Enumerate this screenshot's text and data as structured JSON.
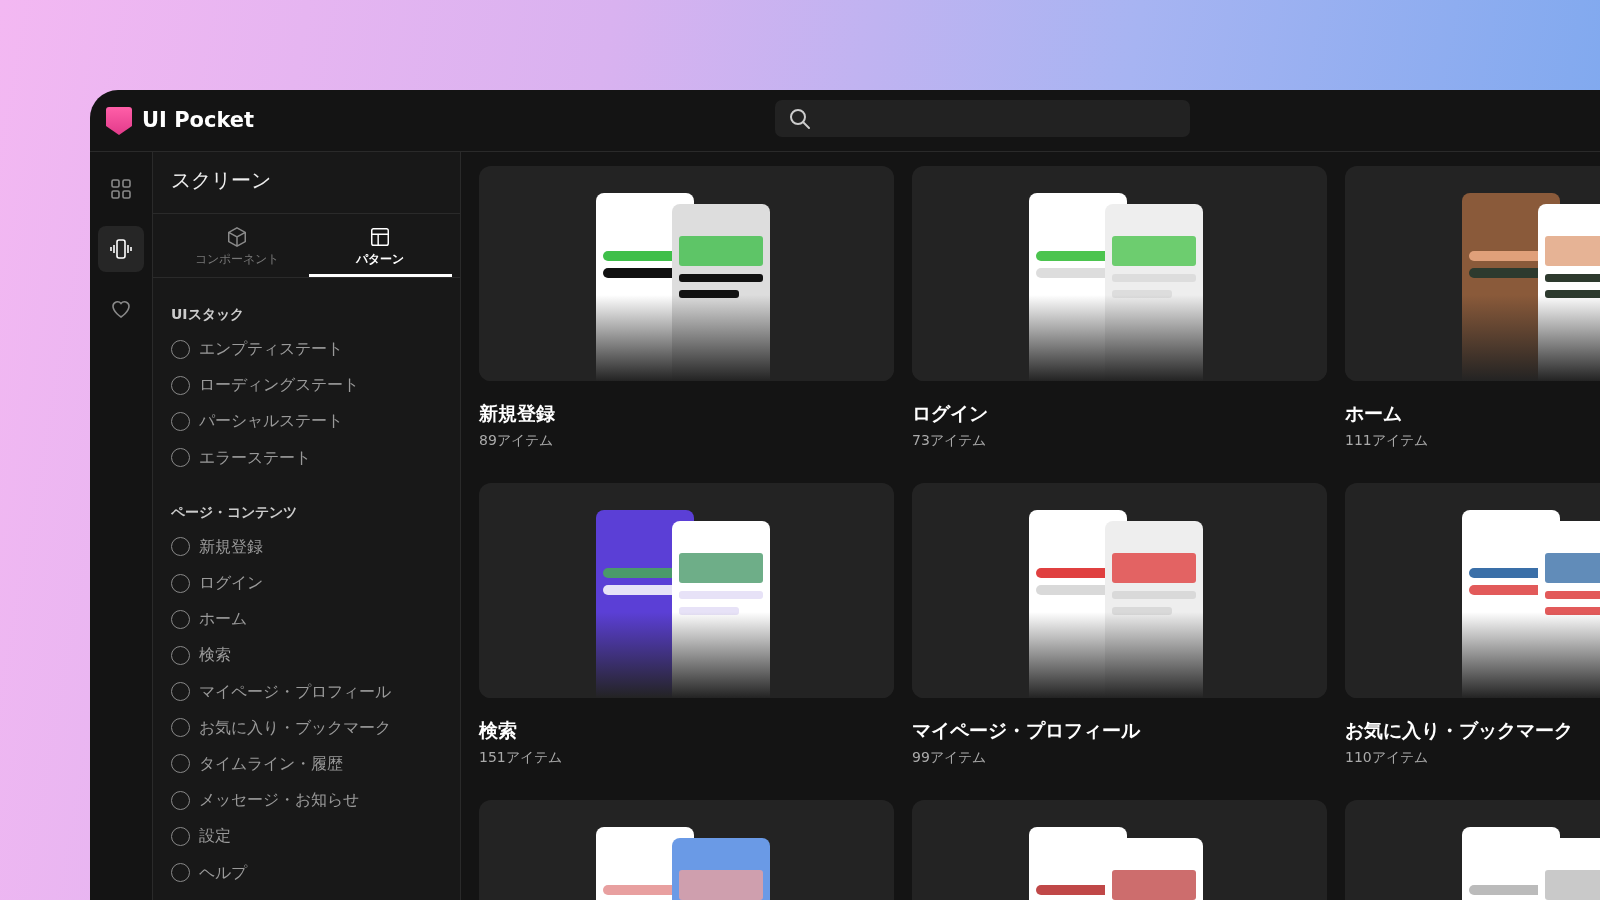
{
  "app": {
    "name": "UI Pocket"
  },
  "rail": [
    {
      "kind": "grid",
      "selected": false
    },
    {
      "kind": "phone",
      "selected": true
    },
    {
      "kind": "heart",
      "selected": false
    }
  ],
  "panel": {
    "title": "スクリーン",
    "tabs": [
      {
        "label": "コンポーネント",
        "kind": "cube",
        "selected": false
      },
      {
        "label": "パターン",
        "kind": "layout",
        "selected": true
      }
    ],
    "groups": [
      {
        "heading": "UIスタック",
        "items": [
          {
            "label": "エンプティステート",
            "checked": false
          },
          {
            "label": "ローディングステート",
            "checked": false
          },
          {
            "label": "パーシャルステート",
            "checked": false
          },
          {
            "label": "エラーステート",
            "checked": false
          }
        ]
      },
      {
        "heading": "ページ・コンテンツ",
        "items": [
          {
            "label": "新規登録",
            "checked": false
          },
          {
            "label": "ログイン",
            "checked": false
          },
          {
            "label": "ホーム",
            "checked": false
          },
          {
            "label": "検索",
            "checked": false
          },
          {
            "label": "マイページ・プロフィール",
            "checked": false
          },
          {
            "label": "お気に入り・ブックマーク",
            "checked": false
          },
          {
            "label": "タイムライン・履歴",
            "checked": false
          },
          {
            "label": "メッセージ・お知らせ",
            "checked": false
          },
          {
            "label": "設定",
            "checked": false
          },
          {
            "label": "ヘルプ",
            "checked": false
          }
        ]
      }
    ]
  },
  "cards": [
    {
      "title": "新規登録",
      "count": "89アイテム",
      "thumbnail": {
        "kind": "picture"
      }
    },
    {
      "title": "ログイン",
      "count": "73アイテム",
      "thumbnail": {
        "kind": "picture"
      }
    },
    {
      "title": "ホーム",
      "count": "111アイテム",
      "thumbnail": {
        "kind": "picture"
      }
    },
    {
      "title": "検索",
      "count": "151アイテム",
      "thumbnail": {
        "kind": "picture"
      }
    },
    {
      "title": "マイページ・プロフィール",
      "count": "99アイテム",
      "thumbnail": {
        "kind": "picture"
      }
    },
    {
      "title": "お気に入り・ブックマーク",
      "count": "110アイテム",
      "thumbnail": {
        "kind": "picture"
      }
    },
    {
      "thumbnail": {
        "kind": "picture"
      }
    },
    {
      "thumbnail": {
        "kind": "picture"
      }
    },
    {
      "thumbnail": {
        "kind": "picture"
      }
    }
  ]
}
